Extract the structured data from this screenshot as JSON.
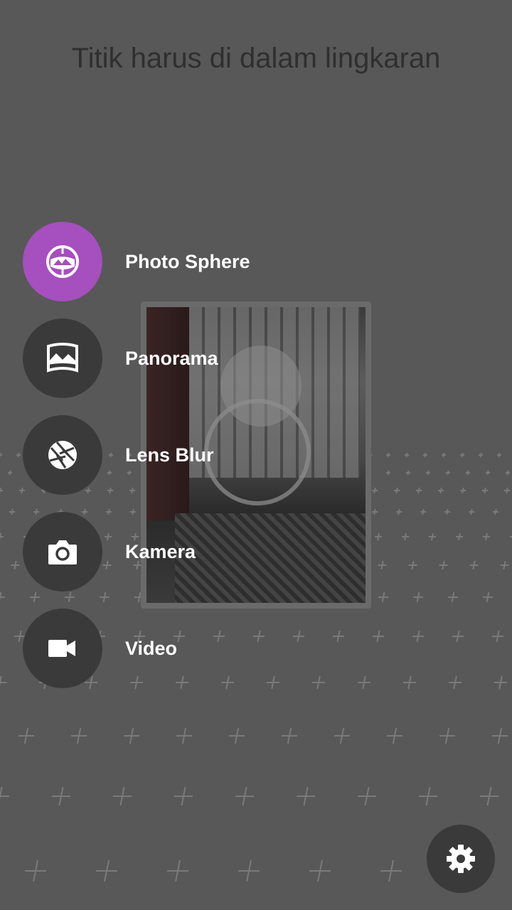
{
  "instruction": "Titik harus di dalam lingkaran",
  "modes": [
    {
      "label": "Photo Sphere",
      "icon": "photo-sphere-icon",
      "active": true
    },
    {
      "label": "Panorama",
      "icon": "panorama-icon",
      "active": false
    },
    {
      "label": "Lens Blur",
      "icon": "lens-blur-icon",
      "active": false
    },
    {
      "label": "Kamera",
      "icon": "camera-icon",
      "active": false
    },
    {
      "label": "Video",
      "icon": "video-icon",
      "active": false
    }
  ],
  "settings_icon": "settings-gear-icon",
  "colors": {
    "accent": "#a64fbf",
    "background": "#585858",
    "button": "#3a3a3a"
  }
}
